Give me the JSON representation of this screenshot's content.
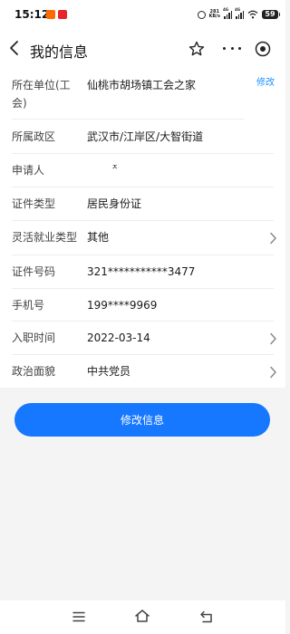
{
  "status_bar": {
    "time": "15:12",
    "net_speed_value": "281",
    "net_speed_unit": "KB/s",
    "signal_1_label": "4G",
    "signal_2_label": "4G",
    "battery": "59",
    "app_badge_colors": [
      "#ff6a00",
      "#e8232b"
    ]
  },
  "nav": {
    "title": "我的信息",
    "icons": [
      "back-icon",
      "star-icon",
      "more-icon",
      "target-icon"
    ]
  },
  "form": {
    "edit_label": "修改",
    "rows": [
      {
        "label": "所在单位(工会)",
        "value": "仙桃市胡场镇工会之家",
        "has_chevron": false
      },
      {
        "label": "所属政区",
        "value": "武汉市/江岸区/大智街道",
        "has_chevron": false
      },
      {
        "label": "申请人",
        "value": "ㅈ",
        "has_chevron": false
      },
      {
        "label": "证件类型",
        "value": "居民身份证",
        "has_chevron": false
      },
      {
        "label": "灵活就业类型",
        "value": "其他",
        "has_chevron": true
      },
      {
        "label": "证件号码",
        "value": "321***********3477",
        "has_chevron": false
      },
      {
        "label": "手机号",
        "value": "199****9969",
        "has_chevron": false
      },
      {
        "label": "入职时间",
        "value": "2022-03-14",
        "has_chevron": true
      },
      {
        "label": "政治面貌",
        "value": "中共党员",
        "has_chevron": true
      }
    ]
  },
  "primary_button": {
    "label": "修改信息"
  },
  "colors": {
    "accent": "#1677ff",
    "link": "#1e90ff",
    "page_background": "#f4f4f4"
  },
  "system_nav": [
    "menu-icon",
    "home-icon",
    "back-icon"
  ]
}
